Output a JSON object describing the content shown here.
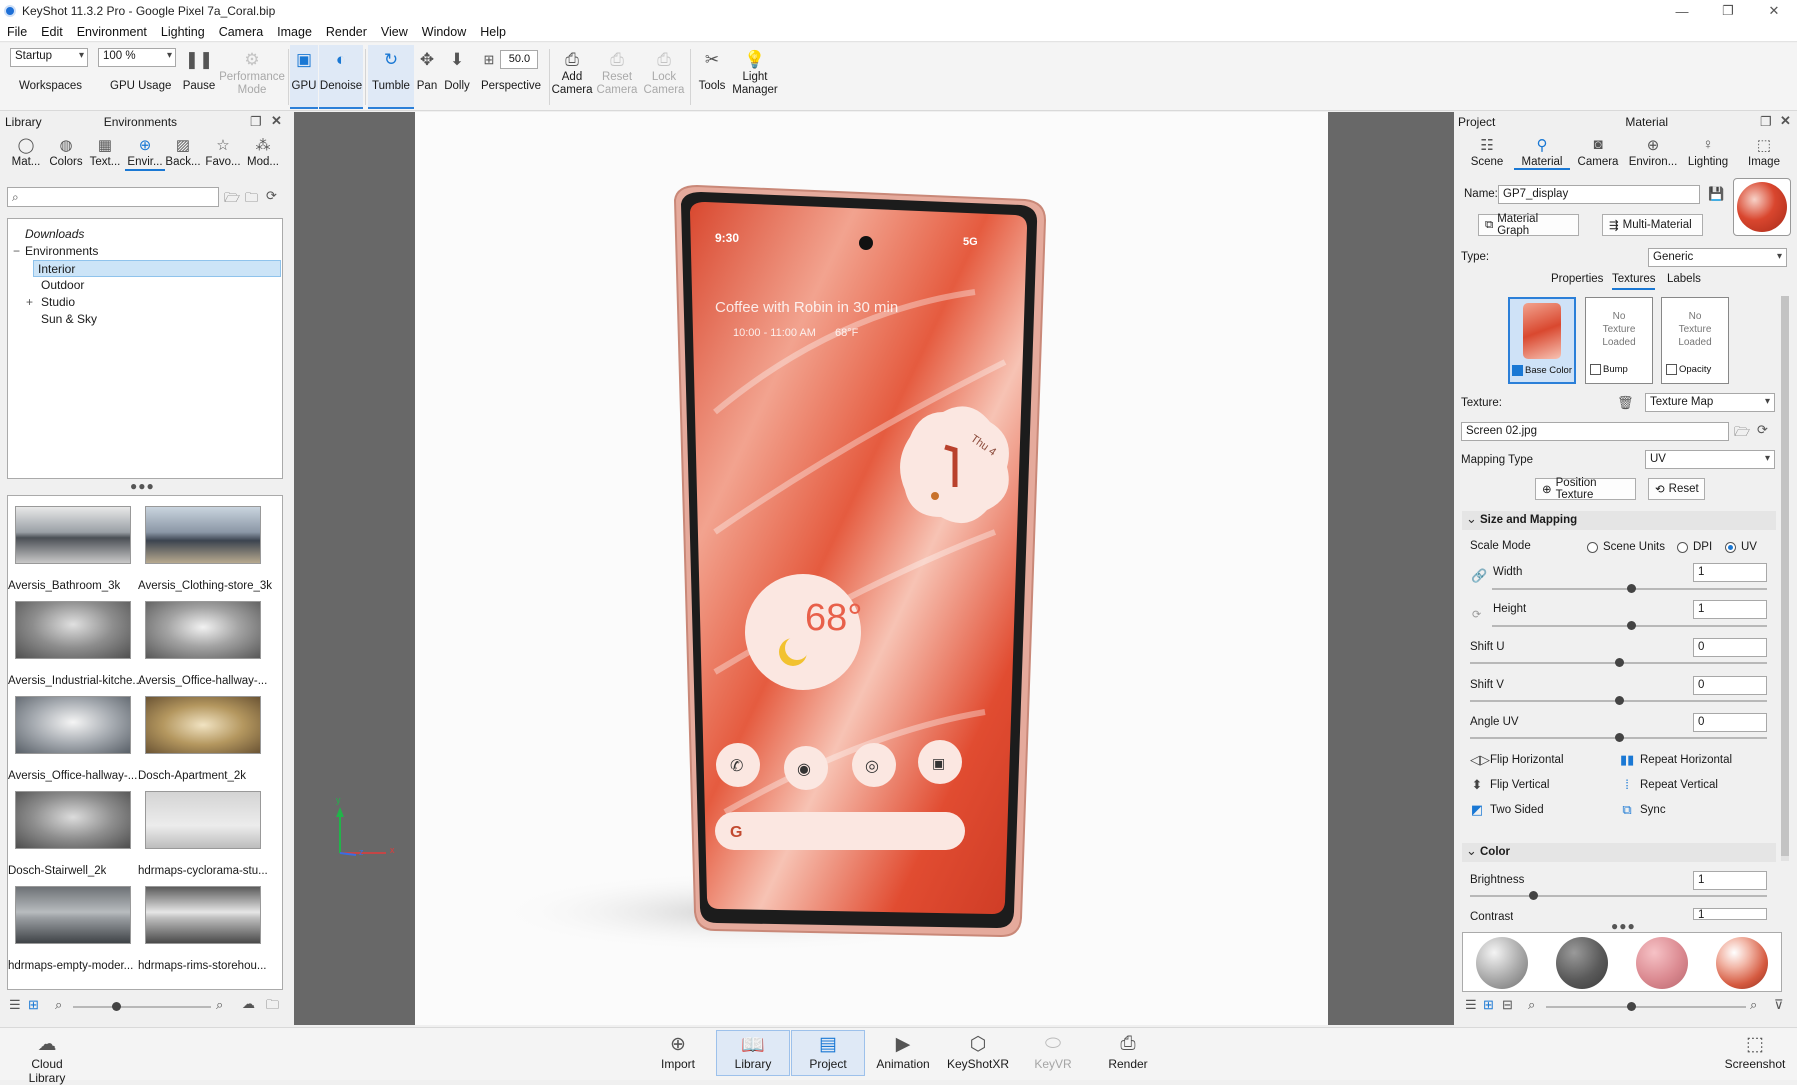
{
  "window": {
    "title": "KeyShot 11.3.2 Pro  -  Google Pixel 7a_Coral.bip"
  },
  "menu": [
    "File",
    "Edit",
    "Environment",
    "Lighting",
    "Camera",
    "Image",
    "Render",
    "View",
    "Window",
    "Help"
  ],
  "toolbar": {
    "workspace_value": "Startup",
    "workspaces_label": "Workspaces",
    "gpu_usage_value": "100 %",
    "gpu_usage_label": "GPU Usage",
    "pause_label": "Pause",
    "performance_mode_label": "Performance Mode",
    "gpu_label": "GPU",
    "denoise_label": "Denoise",
    "tumble_label": "Tumble",
    "pan_label": "Pan",
    "dolly_label": "Dolly",
    "perspective_value": "50.0",
    "perspective_label": "Perspective",
    "add_camera_label": "Add Camera",
    "reset_camera_label": "Reset Camera",
    "lock_camera_label": "Lock Camera",
    "tools_label": "Tools",
    "light_manager_label": "Light Manager"
  },
  "library": {
    "panel_title": "Library",
    "panel_subtitle": "Environments",
    "tabs": [
      "Mat...",
      "Colors",
      "Text...",
      "Envir...",
      "Back...",
      "Favo...",
      "Mod..."
    ],
    "tree": [
      "Downloads",
      "Environments",
      "Interior",
      "Outdoor",
      "Studio",
      "Sun & Sky"
    ],
    "thumbnails": [
      "Aversis_Bathroom_3k",
      "Aversis_Clothing-store_3k",
      "Aversis_Industrial-kitche...",
      "Aversis_Office-hallway-...",
      "Aversis_Office-hallway-...",
      "Dosch-Apartment_2k",
      "Dosch-Stairwell_2k",
      "hdrmaps-cyclorama-stu...",
      "hdrmaps-empty-moder...",
      "hdrmaps-rims-storehou..."
    ]
  },
  "phone_screen": {
    "time": "9:30",
    "network": "5G",
    "event": "Coffee with Robin in 30 min",
    "event_time": "10:00 - 11:00 AM",
    "event_weather": "68°F",
    "clock_date": "Thu 4",
    "temperature": "68°",
    "search_logo": "G"
  },
  "axes": {
    "y": "y",
    "z": "z",
    "x": "x"
  },
  "project": {
    "panel_title": "Project",
    "panel_subtitle": "Material",
    "tabs": [
      "Scene",
      "Material",
      "Camera",
      "Environ...",
      "Lighting",
      "Image"
    ],
    "name_label": "Name:",
    "name_value": "GP7_display",
    "material_graph_label": "Material Graph",
    "multi_material_label": "Multi-Material",
    "type_label": "Type:",
    "type_value": "Generic",
    "subtabs": [
      "Properties",
      "Textures",
      "Labels"
    ],
    "slots": {
      "base_color": "Base Color",
      "no_texture": "No Texture Loaded",
      "bump": "Bump",
      "opacity": "Opacity"
    },
    "texture_label": "Texture:",
    "texture_value": "Texture Map",
    "texture_file": "Screen 02.jpg",
    "mapping_type_label": "Mapping Type",
    "mapping_type_value": "UV",
    "position_texture_label": "Position Texture",
    "reset_label": "Reset",
    "size_mapping_header": "Size and Mapping",
    "scale_mode_label": "Scale Mode",
    "scale_options": [
      "Scene Units",
      "DPI",
      "UV"
    ],
    "width_label": "Width",
    "width_value": "1",
    "height_label": "Height",
    "height_value": "1",
    "shift_u_label": "Shift U",
    "shift_u_value": "0",
    "shift_v_label": "Shift V",
    "shift_v_value": "0",
    "angle_uv_label": "Angle UV",
    "angle_uv_value": "0",
    "flip_horizontal": "Flip Horizontal",
    "repeat_horizontal": "Repeat Horizontal",
    "flip_vertical": "Flip Vertical",
    "repeat_vertical": "Repeat Vertical",
    "two_sided": "Two Sided",
    "sync": "Sync",
    "color_header": "Color",
    "brightness_label": "Brightness",
    "brightness_value": "1",
    "contrast_label": "Contrast",
    "contrast_value": "1"
  },
  "bottombar": {
    "cloud_library": "Cloud Library",
    "items": [
      "Import",
      "Library",
      "Project",
      "Animation",
      "KeyShotXR",
      "KeyVR",
      "Render"
    ],
    "screenshot": "Screenshot"
  },
  "colors": {
    "accent": "#1a78d4",
    "phone_body": "#e3a89a",
    "screen_orange": "#e8553c"
  }
}
